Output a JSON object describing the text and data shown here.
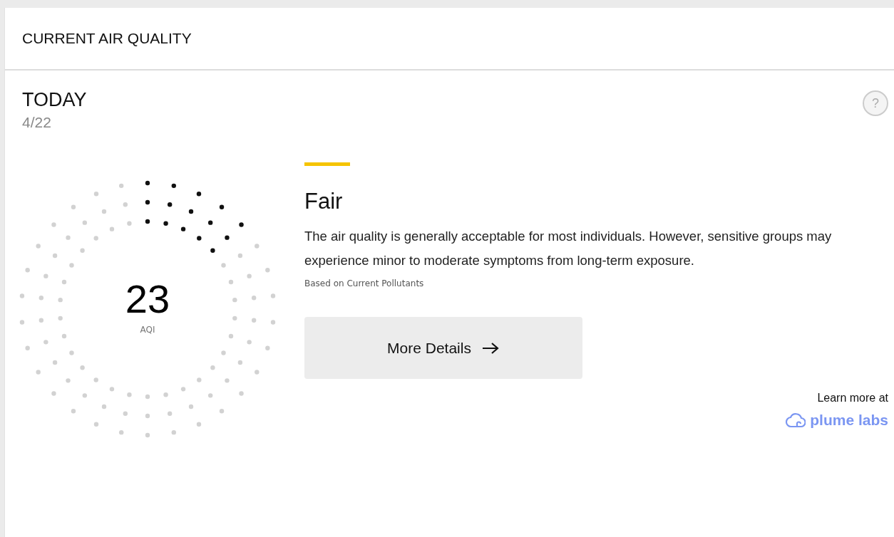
{
  "header": {
    "title": "CURRENT AIR QUALITY"
  },
  "day": {
    "label": "TODAY",
    "date": "4/22",
    "help_icon": "?"
  },
  "gauge": {
    "value": "23",
    "unit": "AQI"
  },
  "status": {
    "color": "#f5c400",
    "title": "Fair",
    "description": "The air quality is generally acceptable for most individuals. However, sensitive groups may experience minor to moderate symptoms from long-term exposure.",
    "note": "Based on Current Pollutants"
  },
  "button": {
    "label": "More Details"
  },
  "credit": {
    "text": "Learn more at",
    "brand": "plume labs"
  }
}
